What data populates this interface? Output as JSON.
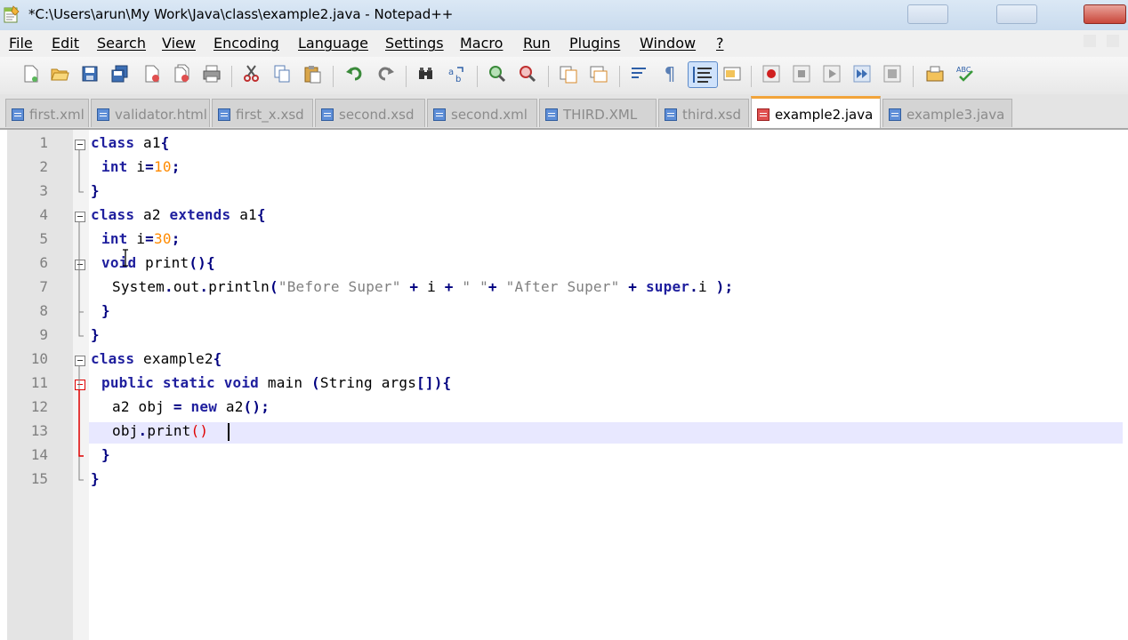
{
  "window": {
    "title": "*C:\\Users\\arun\\My Work\\Java\\class\\example2.java - Notepad++"
  },
  "menu": {
    "items": [
      "File",
      "Edit",
      "Search",
      "View",
      "Encoding",
      "Language",
      "Settings",
      "Macro",
      "Run",
      "Plugins",
      "Window",
      "?"
    ]
  },
  "tabs": [
    {
      "label": "first.xml",
      "active": false
    },
    {
      "label": "validator.html",
      "active": false
    },
    {
      "label": "first_x.xsd",
      "active": false
    },
    {
      "label": "second.xsd",
      "active": false
    },
    {
      "label": "second.xml",
      "active": false
    },
    {
      "label": "THIRD.XML",
      "active": false
    },
    {
      "label": "third.xsd",
      "active": false
    },
    {
      "label": "example2.java",
      "active": true
    },
    {
      "label": "example3.java",
      "active": false
    }
  ],
  "toolbar": {
    "icons": [
      "new-file-icon",
      "open-file-icon",
      "save-icon",
      "save-all-icon",
      "close-icon",
      "close-all-icon",
      "print-icon",
      "cut-icon",
      "copy-icon",
      "paste-icon",
      "undo-icon",
      "redo-icon",
      "find-icon",
      "replace-icon",
      "zoom-in-icon",
      "zoom-out-icon",
      "sync-vertical-icon",
      "sync-horizontal-icon",
      "word-wrap-icon",
      "show-all-chars-icon",
      "indent-guide-icon",
      "user-lang-icon",
      "record-macro-icon",
      "stop-record-icon",
      "play-macro-icon",
      "run-multiple-macro-icon",
      "save-macro-icon",
      "save-session-icon",
      "spellcheck-icon"
    ]
  },
  "editor": {
    "lines": [
      {
        "n": "1",
        "code": "class a1{"
      },
      {
        "n": "2",
        "code": "int i=10;"
      },
      {
        "n": "3",
        "code": "}"
      },
      {
        "n": "4",
        "code": "class a2 extends a1{"
      },
      {
        "n": "5",
        "code": "int i=30;"
      },
      {
        "n": "6",
        "code": "void print(){"
      },
      {
        "n": "7",
        "code": "System.out.println(\"Before Super\" + i + \" \"+ \"After Super\" + super.i );"
      },
      {
        "n": "8",
        "code": "}"
      },
      {
        "n": "9",
        "code": "}"
      },
      {
        "n": "10",
        "code": "class example2{"
      },
      {
        "n": "11",
        "code": "public static void main (String args[]){"
      },
      {
        "n": "12",
        "code": "a2 obj = new a2();"
      },
      {
        "n": "13",
        "code": "obj.print()"
      },
      {
        "n": "14",
        "code": "}"
      },
      {
        "n": "15",
        "code": "}"
      }
    ],
    "current_line": "13"
  },
  "colors": {
    "keyword": "#1f1f9e",
    "number": "#ff8a00",
    "string": "#808080",
    "brace_match": "#e00000",
    "active_tab_accent": "#f2a43a"
  }
}
